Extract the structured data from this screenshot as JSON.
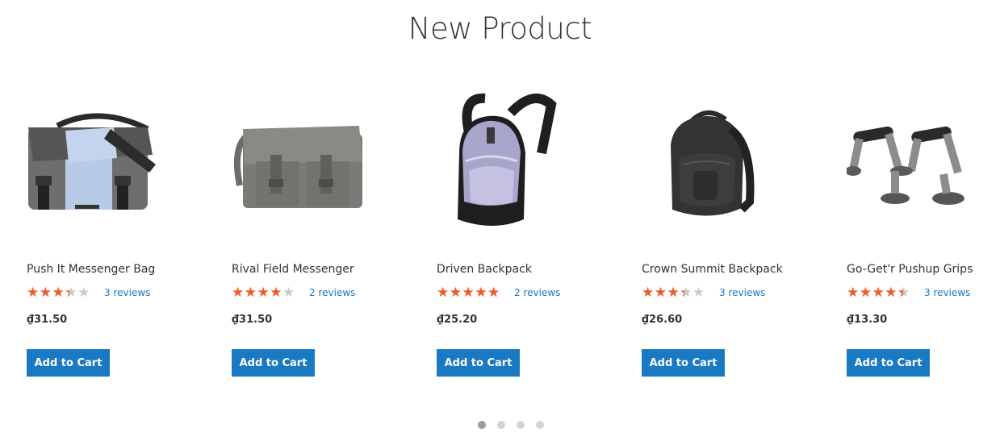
{
  "section": {
    "title": "New Product"
  },
  "products": [
    {
      "name": "Push It Messenger Bag",
      "rating": 0.6,
      "reviews": "3 reviews",
      "price": "₫31.50",
      "button": "Add to Cart",
      "image_icon": "messenger-bag-icon"
    },
    {
      "name": "Rival Field Messenger",
      "rating": 0.7,
      "reviews": "2 reviews",
      "price": "₫31.50",
      "button": "Add to Cart",
      "image_icon": "field-messenger-bag-icon"
    },
    {
      "name": "Driven Backpack",
      "rating": 0.9,
      "reviews": "2 reviews",
      "price": "₫25.20",
      "button": "Add to Cart",
      "image_icon": "backpack-icon"
    },
    {
      "name": "Crown Summit Backpack",
      "rating": 0.6,
      "reviews": "3 reviews",
      "price": "₫26.60",
      "button": "Add to Cart",
      "image_icon": "black-backpack-icon"
    },
    {
      "name": "Go-Get'r Pushup Grips",
      "rating": 0.8,
      "reviews": "3 reviews",
      "price": "₫13.30",
      "button": "Add to Cart",
      "image_icon": "pushup-grips-icon"
    }
  ],
  "pagination": {
    "pages": 4,
    "active": 1
  },
  "colors": {
    "accent": "#1979c3",
    "star": "#f15a29",
    "star_empty": "#c9c9c9"
  }
}
